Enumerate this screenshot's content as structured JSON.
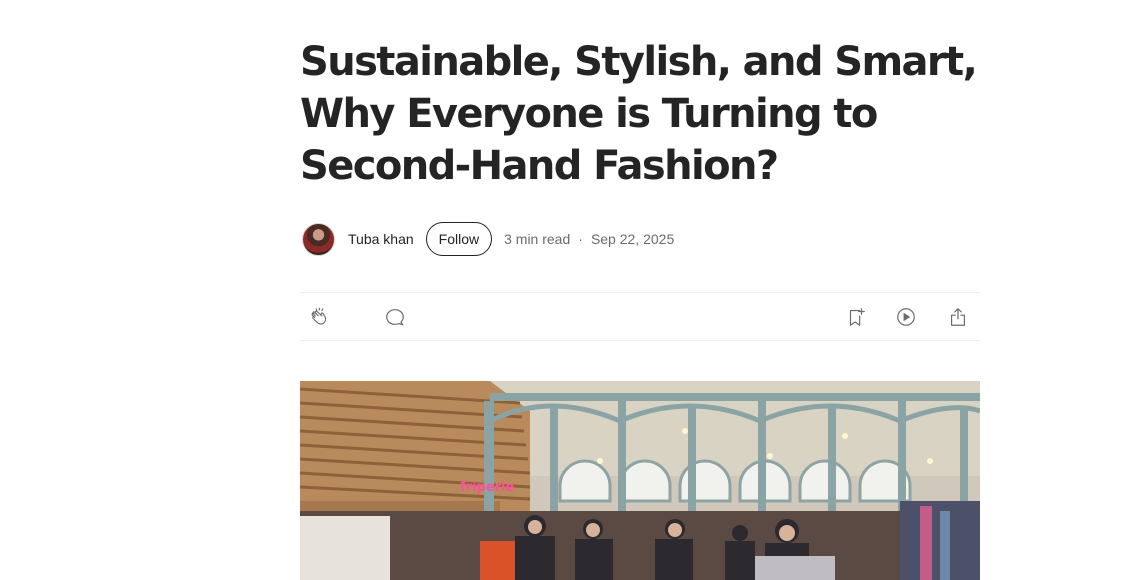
{
  "article": {
    "title": "Sustainable, Stylish, and Smart, Why Everyone is Turning to Second-Hand Fashion?",
    "author": "Tuba khan",
    "follow_label": "Follow",
    "read_time": "3 min read",
    "separator": "·",
    "date": "Sep 22, 2025"
  },
  "icons": {
    "clap": "clap-icon",
    "response": "response-bubble-icon",
    "bookmark": "bookmark-add-icon",
    "listen": "play-circle-icon",
    "share": "share-icon"
  },
  "hero_image": {
    "sign_text": "friperie"
  }
}
